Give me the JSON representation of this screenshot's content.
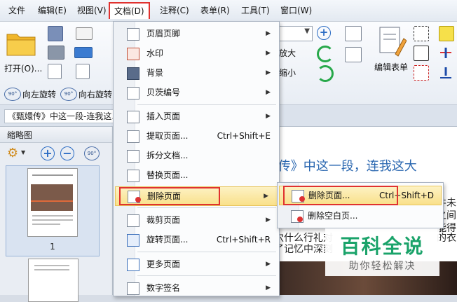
{
  "menubar": {
    "items": [
      "文件",
      "编辑(E)",
      "视图(V)",
      "文档(D)",
      "注释(C)",
      "表单(R)",
      "工具(T)",
      "窗口(W)"
    ]
  },
  "ribbon": {
    "open_label": "打开(O)...",
    "rotate_left": "向左旋转",
    "rotate_right": "向右旋转",
    "zoom_in": "放大",
    "zoom_out": "缩小",
    "edit_form": "编辑表单",
    "rotate_badge": "90°"
  },
  "doc_tab": {
    "title": "《甄嬛传》中这一段-连我这..."
  },
  "thumbnails": {
    "title": "缩略图",
    "page_number": "1"
  },
  "document": {
    "heading": "甄   传》中这一段，连我这大",
    "line1": "井未",
    "line2": "之间",
    "line3": "能得",
    "line4": "穴什么行礼对",
    "line4b": "的衣",
    "line5": "了记忆中深刻"
  },
  "doc_menu": {
    "items": [
      {
        "label": "页眉页脚",
        "shortcut": "",
        "arrow": "▶",
        "icon": "header-footer-icon"
      },
      {
        "label": "水印",
        "shortcut": "",
        "arrow": "▶",
        "icon": "watermark-icon"
      },
      {
        "label": "背景",
        "shortcut": "",
        "arrow": "▶",
        "icon": "background-icon"
      },
      {
        "label": "贝茨编号",
        "shortcut": "",
        "arrow": "▶",
        "icon": "bates-number-icon"
      },
      {
        "label": "插入页面",
        "shortcut": "",
        "arrow": "▶",
        "icon": "insert-page-icon"
      },
      {
        "label": "提取页面...",
        "shortcut": "Ctrl+Shift+E",
        "arrow": "",
        "icon": "extract-page-icon"
      },
      {
        "label": "拆分文档...",
        "shortcut": "",
        "arrow": "",
        "icon": "split-document-icon"
      },
      {
        "label": "替换页面...",
        "shortcut": "",
        "arrow": "",
        "icon": "replace-page-icon"
      },
      {
        "label": "删除页面",
        "shortcut": "",
        "arrow": "▶",
        "icon": "delete-page-icon"
      },
      {
        "label": "裁剪页面",
        "shortcut": "",
        "arrow": "▶",
        "icon": "crop-page-icon"
      },
      {
        "label": "旋转页面...",
        "shortcut": "Ctrl+Shift+R",
        "arrow": "",
        "icon": "rotate-page-icon"
      },
      {
        "label": "更多页面",
        "shortcut": "",
        "arrow": "▶",
        "icon": "more-pages-icon"
      },
      {
        "label": "数字签名",
        "shortcut": "",
        "arrow": "▶",
        "icon": "digital-signature-icon"
      }
    ]
  },
  "delete_submenu": {
    "items": [
      {
        "label": "删除页面...",
        "shortcut": "Ctrl+Shift+D"
      },
      {
        "label": "删除空白页..."
      }
    ]
  },
  "watermark": {
    "main": "百科全说",
    "sub": "助你轻松解决"
  },
  "colors": {
    "highlight_red": "#e0322f",
    "accent_blue": "#2b6cc4",
    "watermark_green": "#1aa36a"
  }
}
